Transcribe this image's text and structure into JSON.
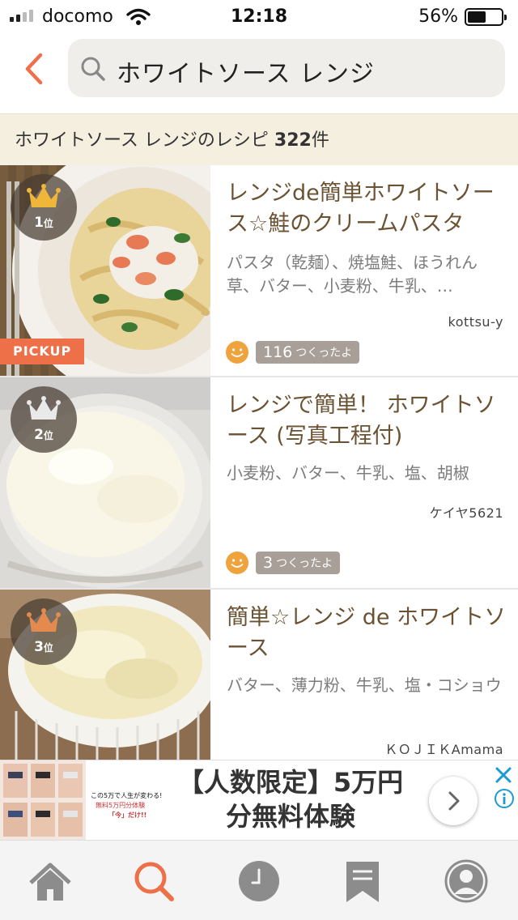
{
  "status_bar": {
    "carrier": "docomo",
    "time": "12:18",
    "battery_percent": "56%",
    "battery_level": 0.56
  },
  "search": {
    "query": "ホワイトソース レンジ"
  },
  "results_header": {
    "prefix": "ホワイトソース レンジのレシピ ",
    "count": "322",
    "suffix": "件"
  },
  "recipes": [
    {
      "rank": "1",
      "rank_suffix": "位",
      "crown_color": "#f0b63a",
      "badge": "PICKUP",
      "title": "レンジde簡単ホワイトソース☆鮭のクリームパスタ",
      "ingredients": "パスタ（乾麺）、焼塩鮭、ほうれん草、バター、小麦粉、牛乳、…",
      "author": "kottsu-y",
      "tsukurepo_count": "116",
      "tsukurepo_label": "つくったよ"
    },
    {
      "rank": "2",
      "rank_suffix": "位",
      "crown_color": "#e9e9e9",
      "title": "レンジで簡単！ ホワイトソース (写真工程付)",
      "ingredients": "小麦粉、バター、牛乳、塩、胡椒",
      "author": "ケイヤ5621",
      "tsukurepo_count": "3",
      "tsukurepo_label": "つくったよ"
    },
    {
      "rank": "3",
      "rank_suffix": "位",
      "crown_color": "#e58a4e",
      "title": "簡単☆レンジ de ホワイトソース",
      "ingredients": "バター、薄力粉、牛乳、塩・コショウ",
      "author": "ＫＯＪＩＫAmama"
    }
  ],
  "ad": {
    "headline": "【人数限定】5万円分無料体験",
    "promo_line1": "この5万で人生が変わる!",
    "promo_line2": "無料5万円分体験",
    "promo_line3": "「今」だけ!!"
  },
  "tabs": [
    {
      "name": "home-icon",
      "active": false
    },
    {
      "name": "search-icon",
      "active": true
    },
    {
      "name": "history-clock-icon",
      "active": false
    },
    {
      "name": "bookmark-icon",
      "active": false
    },
    {
      "name": "account-icon",
      "active": false
    }
  ],
  "colors": {
    "accent": "#ee7048",
    "title_brown": "#6b5233",
    "count_bar_bg": "#f5efe0",
    "tsukurepo_badge": "#a79f98",
    "smiley": "#f0a33c"
  }
}
